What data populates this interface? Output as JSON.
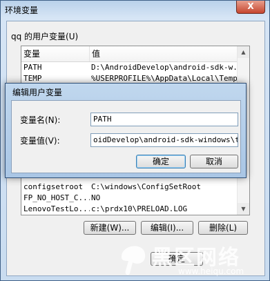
{
  "outer_window": {
    "title": "环境变量",
    "close_label": "X",
    "group_label": "qq 的用户变量(U)",
    "list_headers": [
      "变量",
      "值"
    ],
    "rows_top": [
      {
        "name": "PATH",
        "value": "D:\\AndroidDevelop\\android-sdk-w..."
      },
      {
        "name": "TEMP",
        "value": "%USERPROFILE%\\AppData\\Local\\Temp"
      }
    ],
    "rows_bottom": [
      {
        "name": "configsetroot",
        "value": "C:\\windows\\ConfigSetRoot"
      },
      {
        "name": "FP_NO_HOST_C...",
        "value": "NO"
      },
      {
        "name": "LenovoTestLo...",
        "value": "c:\\prdx10\\PRELOAD.LOG"
      }
    ],
    "buttons": {
      "new": "新建(W)...",
      "edit": "编辑(I)...",
      "delete": "删除(L)"
    },
    "ok_label": "确定"
  },
  "edit_dialog": {
    "title": "编辑用户变量",
    "name_label": "变量名(N):",
    "name_value": "PATH",
    "value_label": "变量值(V):",
    "value_value": "oidDevelop\\android-sdk-windows\\tools",
    "ok_label": "确定",
    "cancel_label": "取消"
  },
  "watermark": {
    "brand": "黑区网络",
    "url": "www.heiqu.com"
  },
  "colors": {
    "title_bar": "#b9d1ea",
    "dialog_frame": "#a9c6e5",
    "close_button": "#c6462f"
  }
}
